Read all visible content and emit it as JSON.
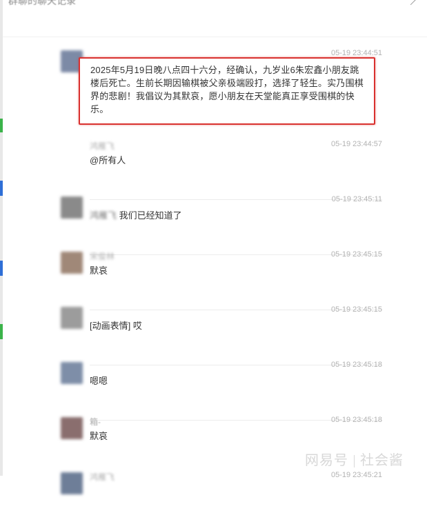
{
  "window": {
    "title": "群聊的聊天记录"
  },
  "highlighted_message": {
    "text": "2025年5月19日晚八点四十六分，经确认，九岁业6朱宏鑫小朋友跳楼后死亡。生前长期因输棋被父亲极端殴打，选择了轻生。实乃围棋界的悲剧！我倡议为其默哀，愿小朋友在天堂能真正享受围棋的快乐。"
  },
  "messages": [
    {
      "time": "05-19 23:44:51",
      "sender": "",
      "content": "",
      "avatar_color": "#7c8aa6"
    },
    {
      "time": "05-19 23:44:57",
      "sender": "鸿雁飞",
      "content": "@所有人",
      "avatar_color": ""
    },
    {
      "time": "05-19 23:45:11",
      "sender": "",
      "content_blurred": "鸿雁飞",
      "content": "我们已经知道了",
      "avatar_color": "#8a8a8a"
    },
    {
      "time": "05-19 23:45:15",
      "sender": "宋俊林",
      "content": "默哀",
      "avatar_color": "#a08878"
    },
    {
      "time": "05-19 23:45:15",
      "sender": "",
      "content": "[动画表情] 哎",
      "avatar_color": "#9c9c9c"
    },
    {
      "time": "05-19 23:45:18",
      "sender": "",
      "content": "嗯嗯",
      "avatar_color": "#7e8ea8"
    },
    {
      "time": "05-19 23:45:18",
      "sender": "箱-",
      "content": "默哀",
      "avatar_color": "#8a6e6e"
    },
    {
      "time": "05-19 23:45:21",
      "sender": "鸿雁飞",
      "content": "",
      "avatar_color": "#6e7e98"
    }
  ],
  "watermark": {
    "left": "网易号",
    "right": "社会酱"
  },
  "colors": {
    "highlight_border": "#d9312f",
    "time": "#b2b2b2",
    "text": "#333333"
  },
  "icons": {
    "corner": "chevron-icon"
  }
}
